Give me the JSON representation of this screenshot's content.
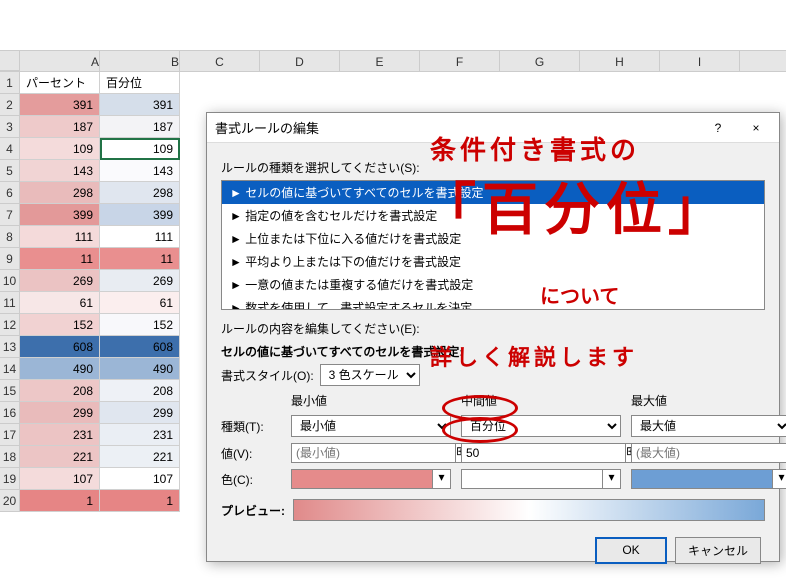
{
  "columns": [
    "A",
    "B",
    "C",
    "D",
    "E",
    "F",
    "G",
    "H",
    "I"
  ],
  "header_row": {
    "A": "パーセント",
    "B": "百分位"
  },
  "rows": [
    {
      "n": 2,
      "a": 391,
      "b": 391,
      "ac": "#e49c9c",
      "bc": "#d5deea"
    },
    {
      "n": 3,
      "a": 187,
      "b": 187,
      "ac": "#eecaca",
      "bc": "#f3f3f6"
    },
    {
      "n": 4,
      "a": 109,
      "b": 109,
      "ac": "#f4dbdb",
      "bc": "#ffffff"
    },
    {
      "n": 5,
      "a": 143,
      "b": 143,
      "ac": "#f1d4d4",
      "bc": "#fafafd"
    },
    {
      "n": 6,
      "a": 298,
      "b": 298,
      "ac": "#e9bbbb",
      "bc": "#e0e6ef"
    },
    {
      "n": 7,
      "a": 399,
      "b": 399,
      "ac": "#e39999",
      "bc": "#c8d5e7"
    },
    {
      "n": 8,
      "a": 111,
      "b": 111,
      "ac": "#f4dada",
      "bc": "#ffffff"
    },
    {
      "n": 9,
      "a": 11,
      "b": 11,
      "ac": "#e98f8f",
      "bc": "#e98f8f"
    },
    {
      "n": 10,
      "a": 269,
      "b": 269,
      "ac": "#ebc3c3",
      "bc": "#e8ecf2"
    },
    {
      "n": 11,
      "a": 61,
      "b": 61,
      "ac": "#f7e7e7",
      "bc": "#fbeeee"
    },
    {
      "n": 12,
      "a": 152,
      "b": 152,
      "ac": "#f1d2d2",
      "bc": "#f8f8fb"
    },
    {
      "n": 13,
      "a": 608,
      "b": 608,
      "ac": "#3d6fac",
      "bc": "#3d6fac"
    },
    {
      "n": 14,
      "a": 490,
      "b": 490,
      "ac": "#9bb6d6",
      "bc": "#9bb6d6"
    },
    {
      "n": 15,
      "a": 208,
      "b": 208,
      "ac": "#edc7c7",
      "bc": "#eef1f6"
    },
    {
      "n": 16,
      "a": 299,
      "b": 299,
      "ac": "#e9bbbb",
      "bc": "#e0e6ef"
    },
    {
      "n": 17,
      "a": 231,
      "b": 231,
      "ac": "#ecc4c4",
      "bc": "#eaeef4"
    },
    {
      "n": 18,
      "a": 221,
      "b": 221,
      "ac": "#ecc5c5",
      "bc": "#ecf0f5"
    },
    {
      "n": 19,
      "a": 107,
      "b": 107,
      "ac": "#f4dbdb",
      "bc": "#ffffff"
    },
    {
      "n": 20,
      "a": 1,
      "b": 1,
      "ac": "#e68585",
      "bc": "#e68585"
    }
  ],
  "dialog": {
    "title": "書式ルールの編集",
    "help": "?",
    "close": "×",
    "rule_type_label": "ルールの種類を選択してください(S):",
    "rule_types": [
      "► セルの値に基づいてすべてのセルを書式設定",
      "► 指定の値を含むセルだけを書式設定",
      "► 上位または下位に入る値だけを書式設定",
      "► 平均より上または下の値だけを書式設定",
      "► 一意の値または重複する値だけを書式設定",
      "► 数式を使用して、書式設定するセルを決定"
    ],
    "rule_types_selected": 0,
    "content_label": "ルールの内容を編集してください(E):",
    "basis_label": "セルの値に基づいてすべてのセルを書式設定:",
    "style_label": "書式スタイル(O):",
    "style_value": "3 色スケール",
    "cols": {
      "min": "最小値",
      "mid": "中間値",
      "max": "最大値"
    },
    "type_label": "種類(T):",
    "type_vals": {
      "min": "最小値",
      "mid": "百分位",
      "max": "最大値"
    },
    "value_label": "値(V):",
    "value_vals": {
      "min_ph": "(最小値)",
      "mid": "50",
      "max_ph": "(最大値)"
    },
    "color_label": "色(C):",
    "colors": {
      "min": "#e58b8b",
      "mid": "#ffffff",
      "max": "#6d9ed4"
    },
    "preview_label": "プレビュー:",
    "ok": "OK",
    "cancel": "キャンセル"
  },
  "annotation": {
    "l1": "条件付き書式の",
    "l2": "「百分位」",
    "l3": "について",
    "l4": "詳しく解説します"
  }
}
